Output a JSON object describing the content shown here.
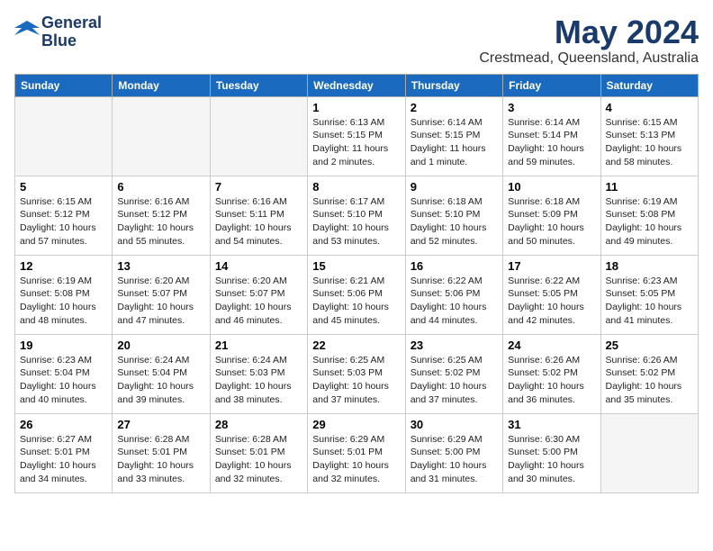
{
  "header": {
    "logo_line1": "General",
    "logo_line2": "Blue",
    "month": "May 2024",
    "location": "Crestmead, Queensland, Australia"
  },
  "weekdays": [
    "Sunday",
    "Monday",
    "Tuesday",
    "Wednesday",
    "Thursday",
    "Friday",
    "Saturday"
  ],
  "weeks": [
    [
      {
        "day": "",
        "info": ""
      },
      {
        "day": "",
        "info": ""
      },
      {
        "day": "",
        "info": ""
      },
      {
        "day": "1",
        "info": "Sunrise: 6:13 AM\nSunset: 5:15 PM\nDaylight: 11 hours\nand 2 minutes."
      },
      {
        "day": "2",
        "info": "Sunrise: 6:14 AM\nSunset: 5:15 PM\nDaylight: 11 hours\nand 1 minute."
      },
      {
        "day": "3",
        "info": "Sunrise: 6:14 AM\nSunset: 5:14 PM\nDaylight: 10 hours\nand 59 minutes."
      },
      {
        "day": "4",
        "info": "Sunrise: 6:15 AM\nSunset: 5:13 PM\nDaylight: 10 hours\nand 58 minutes."
      }
    ],
    [
      {
        "day": "5",
        "info": "Sunrise: 6:15 AM\nSunset: 5:12 PM\nDaylight: 10 hours\nand 57 minutes."
      },
      {
        "day": "6",
        "info": "Sunrise: 6:16 AM\nSunset: 5:12 PM\nDaylight: 10 hours\nand 55 minutes."
      },
      {
        "day": "7",
        "info": "Sunrise: 6:16 AM\nSunset: 5:11 PM\nDaylight: 10 hours\nand 54 minutes."
      },
      {
        "day": "8",
        "info": "Sunrise: 6:17 AM\nSunset: 5:10 PM\nDaylight: 10 hours\nand 53 minutes."
      },
      {
        "day": "9",
        "info": "Sunrise: 6:18 AM\nSunset: 5:10 PM\nDaylight: 10 hours\nand 52 minutes."
      },
      {
        "day": "10",
        "info": "Sunrise: 6:18 AM\nSunset: 5:09 PM\nDaylight: 10 hours\nand 50 minutes."
      },
      {
        "day": "11",
        "info": "Sunrise: 6:19 AM\nSunset: 5:08 PM\nDaylight: 10 hours\nand 49 minutes."
      }
    ],
    [
      {
        "day": "12",
        "info": "Sunrise: 6:19 AM\nSunset: 5:08 PM\nDaylight: 10 hours\nand 48 minutes."
      },
      {
        "day": "13",
        "info": "Sunrise: 6:20 AM\nSunset: 5:07 PM\nDaylight: 10 hours\nand 47 minutes."
      },
      {
        "day": "14",
        "info": "Sunrise: 6:20 AM\nSunset: 5:07 PM\nDaylight: 10 hours\nand 46 minutes."
      },
      {
        "day": "15",
        "info": "Sunrise: 6:21 AM\nSunset: 5:06 PM\nDaylight: 10 hours\nand 45 minutes."
      },
      {
        "day": "16",
        "info": "Sunrise: 6:22 AM\nSunset: 5:06 PM\nDaylight: 10 hours\nand 44 minutes."
      },
      {
        "day": "17",
        "info": "Sunrise: 6:22 AM\nSunset: 5:05 PM\nDaylight: 10 hours\nand 42 minutes."
      },
      {
        "day": "18",
        "info": "Sunrise: 6:23 AM\nSunset: 5:05 PM\nDaylight: 10 hours\nand 41 minutes."
      }
    ],
    [
      {
        "day": "19",
        "info": "Sunrise: 6:23 AM\nSunset: 5:04 PM\nDaylight: 10 hours\nand 40 minutes."
      },
      {
        "day": "20",
        "info": "Sunrise: 6:24 AM\nSunset: 5:04 PM\nDaylight: 10 hours\nand 39 minutes."
      },
      {
        "day": "21",
        "info": "Sunrise: 6:24 AM\nSunset: 5:03 PM\nDaylight: 10 hours\nand 38 minutes."
      },
      {
        "day": "22",
        "info": "Sunrise: 6:25 AM\nSunset: 5:03 PM\nDaylight: 10 hours\nand 37 minutes."
      },
      {
        "day": "23",
        "info": "Sunrise: 6:25 AM\nSunset: 5:02 PM\nDaylight: 10 hours\nand 37 minutes."
      },
      {
        "day": "24",
        "info": "Sunrise: 6:26 AM\nSunset: 5:02 PM\nDaylight: 10 hours\nand 36 minutes."
      },
      {
        "day": "25",
        "info": "Sunrise: 6:26 AM\nSunset: 5:02 PM\nDaylight: 10 hours\nand 35 minutes."
      }
    ],
    [
      {
        "day": "26",
        "info": "Sunrise: 6:27 AM\nSunset: 5:01 PM\nDaylight: 10 hours\nand 34 minutes."
      },
      {
        "day": "27",
        "info": "Sunrise: 6:28 AM\nSunset: 5:01 PM\nDaylight: 10 hours\nand 33 minutes."
      },
      {
        "day": "28",
        "info": "Sunrise: 6:28 AM\nSunset: 5:01 PM\nDaylight: 10 hours\nand 32 minutes."
      },
      {
        "day": "29",
        "info": "Sunrise: 6:29 AM\nSunset: 5:01 PM\nDaylight: 10 hours\nand 32 minutes."
      },
      {
        "day": "30",
        "info": "Sunrise: 6:29 AM\nSunset: 5:00 PM\nDaylight: 10 hours\nand 31 minutes."
      },
      {
        "day": "31",
        "info": "Sunrise: 6:30 AM\nSunset: 5:00 PM\nDaylight: 10 hours\nand 30 minutes."
      },
      {
        "day": "",
        "info": ""
      }
    ]
  ]
}
